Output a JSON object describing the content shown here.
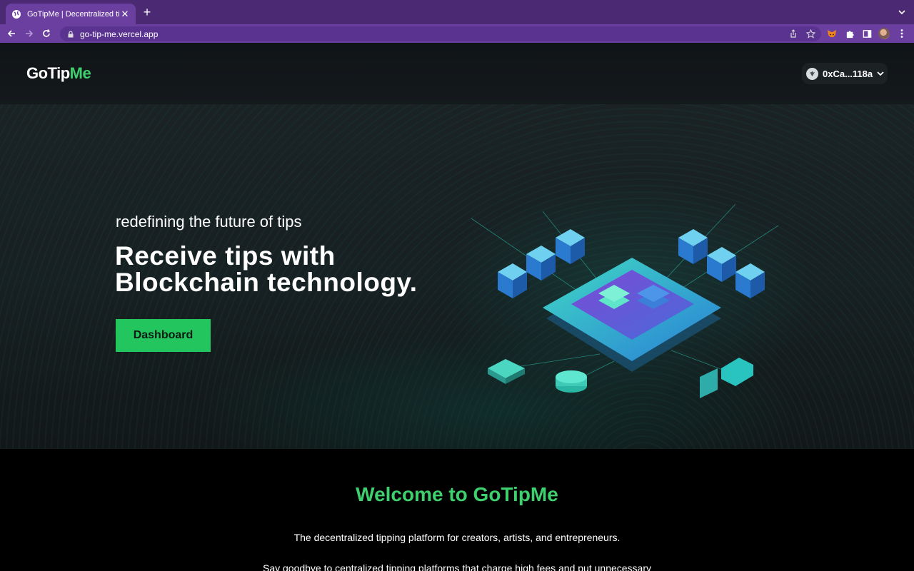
{
  "browser": {
    "tab_title": "GoTipMe | Decentralized tips",
    "url": "go-tip-me.vercel.app",
    "new_tab_label": "+"
  },
  "header": {
    "logo_part1": "GoTip",
    "logo_part2": "Me",
    "wallet_address": "0xCa...118a"
  },
  "hero": {
    "tagline": "redefining the future of tips",
    "headline_line1": "Receive tips with",
    "headline_line2": "Blockchain technology.",
    "cta_label": "Dashboard"
  },
  "welcome": {
    "title": "Welcome to GoTipMe",
    "paragraph1": "The decentralized tipping platform for creators, artists, and entrepreneurs.",
    "paragraph2": "Say goodbye to centralized tipping platforms that charge high fees and put unnecessary"
  },
  "colors": {
    "accent_green": "#3ecf6e",
    "button_green": "#22c55e",
    "browser_purple": "#6b3fa0"
  },
  "icons": [
    "globe-icon",
    "close-icon",
    "plus-icon",
    "back-icon",
    "forward-icon",
    "reload-icon",
    "lock-icon",
    "share-icon",
    "star-icon",
    "metamask-icon",
    "extensions-icon",
    "sidepanel-icon",
    "profile-avatar",
    "menu-icon",
    "wallet-icon",
    "chevron-down-icon"
  ]
}
